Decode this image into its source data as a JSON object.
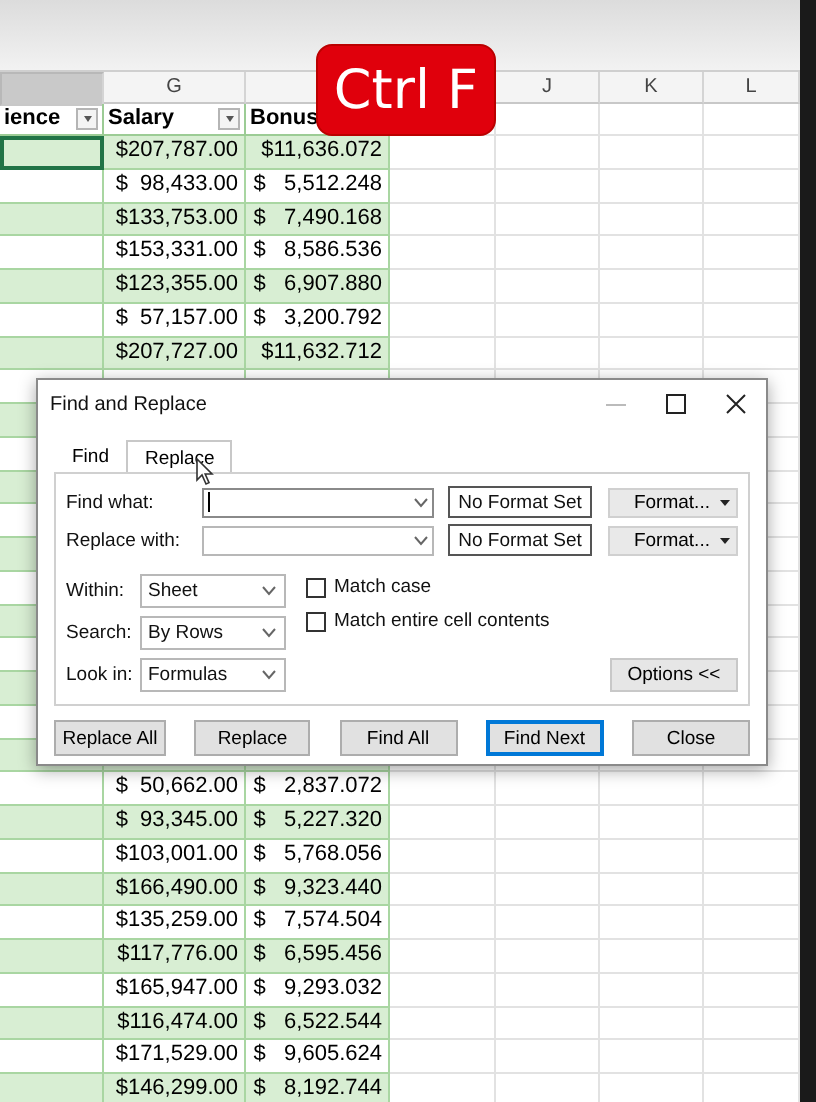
{
  "sheet": {
    "columns": [
      {
        "selected": true
      },
      {
        "letter": "G",
        "selected": false
      },
      {
        "selected": false
      },
      {
        "letter": "J",
        "selected": false
      },
      {
        "letter": "K",
        "selected": false
      },
      {
        "letter": "L",
        "selected": false
      }
    ],
    "fields": [
      {
        "label": "ience",
        "filter": true
      },
      {
        "label": "Salary",
        "filter": true
      },
      {
        "label": "Bonus"
      }
    ],
    "rows_top": [
      {
        "salary": "$207,787.00",
        "bonus": "$11,636.072",
        "shaded": true,
        "active": true
      },
      {
        "salary": "$  98,433.00",
        "bonus": "$   5,512.248",
        "shaded": false,
        "active": false
      },
      {
        "salary": "$133,753.00",
        "bonus": "$   7,490.168",
        "shaded": true,
        "active": false
      },
      {
        "salary": "$153,331.00",
        "bonus": "$   8,586.536",
        "shaded": false,
        "active": false
      },
      {
        "salary": "$123,355.00",
        "bonus": "$   6,907.880",
        "shaded": true,
        "active": false
      },
      {
        "salary": "$  57,157.00",
        "bonus": "$   3,200.792",
        "shaded": false,
        "active": false
      },
      {
        "salary": "$207,727.00",
        "bonus": "$11,632.712",
        "shaded": true,
        "active": false
      }
    ],
    "rows_bottom": [
      {
        "salary": "$  50,662.00",
        "bonus": "$   2,837.072",
        "shaded": false,
        "active": false
      },
      {
        "salary": "$  93,345.00",
        "bonus": "$   5,227.320",
        "shaded": true,
        "active": false
      },
      {
        "salary": "$103,001.00",
        "bonus": "$   5,768.056",
        "shaded": false,
        "active": false
      },
      {
        "salary": "$166,490.00",
        "bonus": "$   9,323.440",
        "shaded": true,
        "active": false
      },
      {
        "salary": "$135,259.00",
        "bonus": "$   7,574.504",
        "shaded": false,
        "active": false
      },
      {
        "salary": "$117,776.00",
        "bonus": "$   6,595.456",
        "shaded": true,
        "active": false
      },
      {
        "salary": "$165,947.00",
        "bonus": "$   9,293.032",
        "shaded": false,
        "active": false
      },
      {
        "salary": "$116,474.00",
        "bonus": "$   6,522.544",
        "shaded": true,
        "active": false
      },
      {
        "salary": "$171,529.00",
        "bonus": "$   9,605.624",
        "shaded": false,
        "active": false
      },
      {
        "salary": "$146,299.00",
        "bonus": "$   8,192.744",
        "shaded": true,
        "active": false
      }
    ]
  },
  "shortcut_badge": "Ctrl F",
  "dialog": {
    "title": "Find and Replace",
    "tabs": [
      {
        "label": "Find",
        "selected": false
      },
      {
        "label": "Replace",
        "selected": true
      }
    ],
    "fields": [
      {
        "label": "Find what:",
        "focused": true,
        "format_status": "No Format Set",
        "format_button": "Format..."
      },
      {
        "label": "Replace with:",
        "focused": false,
        "format_status": "No Format Set",
        "format_button": "Format..."
      }
    ],
    "options": [
      {
        "label": "Within:",
        "value": "Sheet"
      },
      {
        "label": "Search:",
        "value": "By Rows"
      },
      {
        "label": "Look in:",
        "value": "Formulas"
      }
    ],
    "checkboxes": [
      {
        "label": "Match case",
        "checked": false
      },
      {
        "label": "Match entire cell contents",
        "checked": false
      }
    ],
    "options_button": "Options <<",
    "buttons": [
      {
        "label": "Replace All",
        "default": false
      },
      {
        "label": "Replace",
        "default": false
      },
      {
        "label": "Find All",
        "default": false
      },
      {
        "label": "Find Next",
        "default": true
      },
      {
        "label": "Close",
        "default": false
      }
    ]
  }
}
